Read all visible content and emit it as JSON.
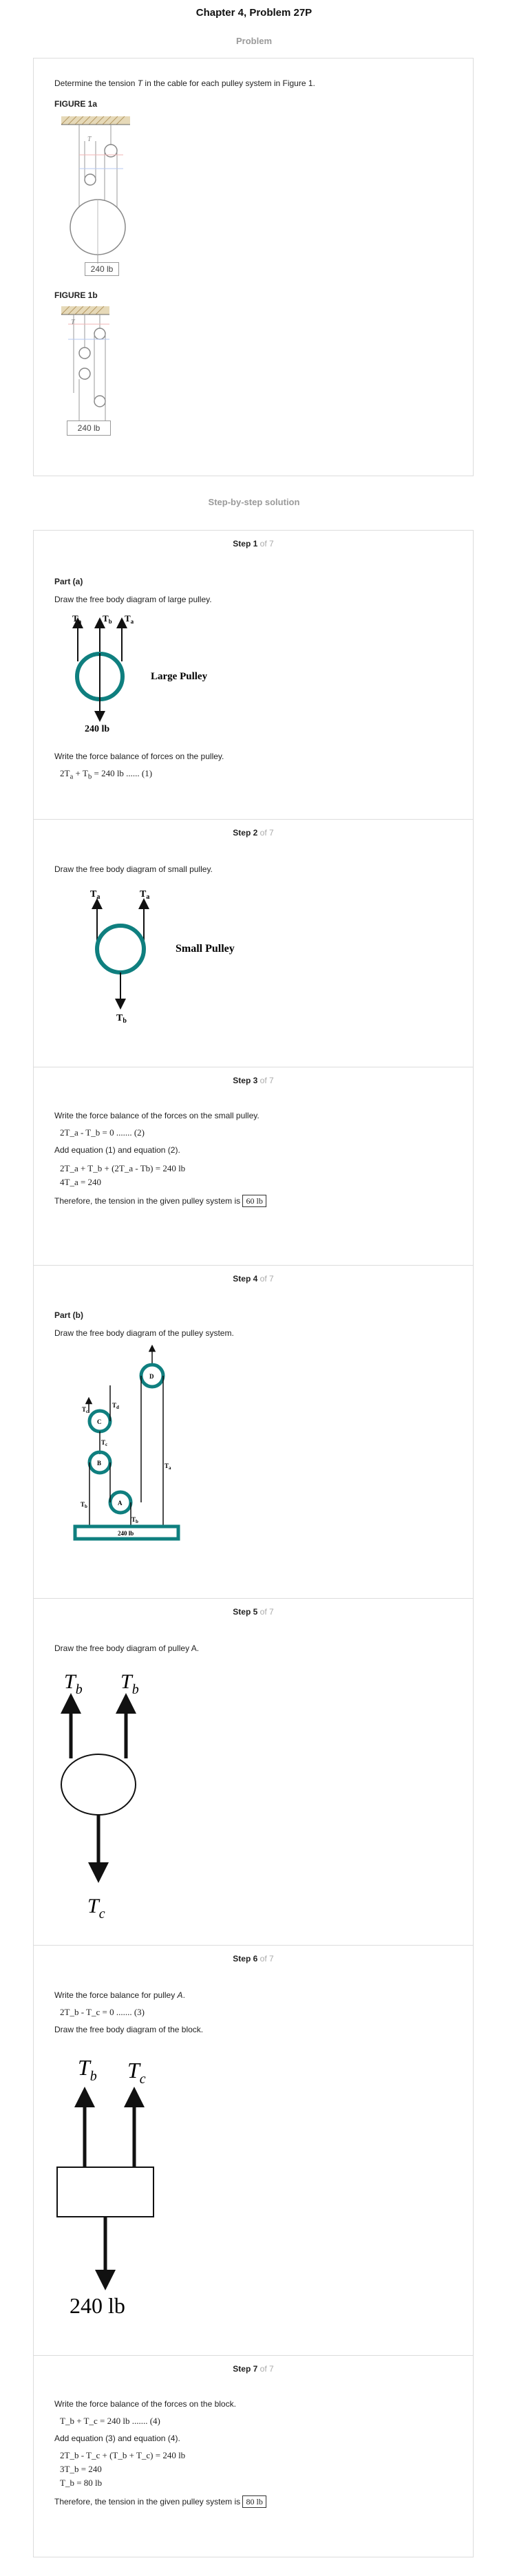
{
  "header": {
    "title": "Chapter 4, Problem 27P",
    "problem_label": "Problem",
    "solution_label": "Step-by-step solution"
  },
  "problem": {
    "statement_pre": "Determine the tension ",
    "statement_var": "T",
    "statement_post": " in the cable for each pulley system in Figure 1.",
    "fig1a_label": "FIGURE 1a",
    "fig1b_label": "FIGURE 1b",
    "fig1a_weight": "240 lb",
    "fig1b_weight": "240 lb",
    "fig_tension_label": "T"
  },
  "step_prefix": "Step ",
  "step_of": " of 7",
  "steps": [
    {
      "num": "1",
      "part": "Part (a)",
      "text1": "Draw the free body diagram of large pulley.",
      "diagram": {
        "ta": "T",
        "ta_sub": "a",
        "tb": "T",
        "tb_sub": "b",
        "name": "Large Pulley",
        "weight": "240 lb"
      },
      "text2": "Write the force balance of forces on the pulley.",
      "eq1": "2T",
      "eq1_sub": "a",
      "eq1_mid": " + T",
      "eq1_sub2": "b",
      "eq1_post": " = 240 lb ...... (1)"
    },
    {
      "num": "2",
      "text1": "Draw the free body diagram of small pulley.",
      "diagram": {
        "ta": "T",
        "ta_sub": "a",
        "tb": "T",
        "tb_sub": "b",
        "name": "Small Pulley"
      }
    },
    {
      "num": "3",
      "text1": "Write the force balance of the forces on the small pulley.",
      "eq1": "2T_a - T_b = 0 ....... (2)",
      "text2": "Add equation (1) and equation (2).",
      "eq2": "2T_a + T_b + (2T_a - Tb) = 240 lb",
      "eq3": "4T_a = 240",
      "text3": "Therefore, the tension in the given pulley system is",
      "answer": "60 lb"
    },
    {
      "num": "4",
      "part": "Part (b)",
      "text1": "Draw the free body diagram of the pulley system.",
      "diagram": {
        "a": "A",
        "b": "B",
        "c": "C",
        "d": "D",
        "weight": "240 lb",
        "ta": "T",
        "ta_sub": "a",
        "tb": "T",
        "tb_sub": "b",
        "tc": "T",
        "tc_sub": "c",
        "td": "T",
        "td_sub": "d"
      }
    },
    {
      "num": "5",
      "text1": "Draw the free body diagram of pulley A.",
      "diagram": {
        "tb": "T",
        "tb_sub": "b",
        "tc": "T",
        "tc_sub": "c"
      }
    },
    {
      "num": "6",
      "text1_pre": "Write the force balance for pulley ",
      "text1_var": "A",
      "text1_post": ".",
      "eq1": "2T_b - T_c = 0 ....... (3)",
      "text2": "Draw the free body diagram of the block.",
      "diagram": {
        "tb": "T",
        "tb_sub": "b",
        "tc": "T",
        "tc_sub": "c",
        "weight": "240 lb"
      }
    },
    {
      "num": "7",
      "text1": "Write the force balance of the forces on the block.",
      "eq1": "T_b + T_c = 240 lb ....... (4)",
      "text2": "Add equation (3) and equation (4).",
      "eq2": "2T_b - T_c + (T_b + T_c) = 240 lb",
      "eq3": "3T_b = 240",
      "eq4": "T_b = 80 lb",
      "text3": "Therefore, the tension in the given pulley system is",
      "answer": "80 lb"
    }
  ],
  "colors": {
    "pulley": "#0f7f7f",
    "card_border": "#dcdcdc",
    "muted": "#9a9a9a"
  }
}
